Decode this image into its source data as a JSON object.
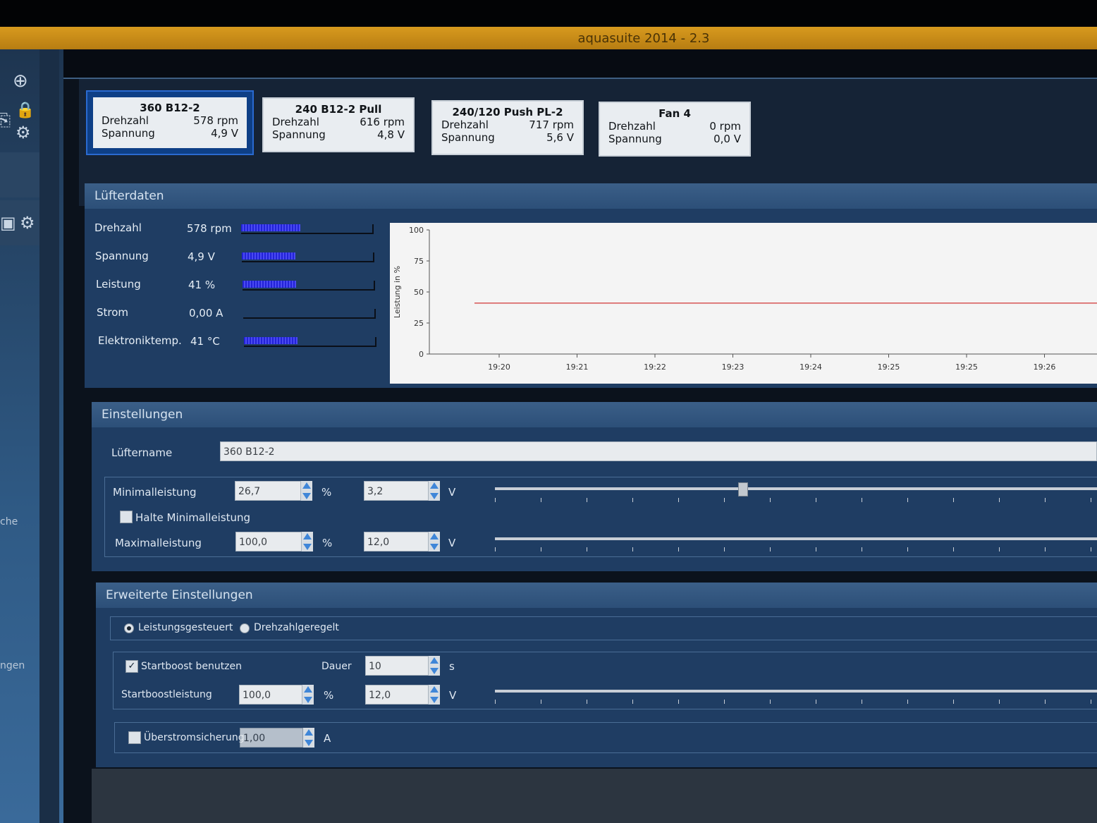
{
  "window": {
    "title": "aquasuite 2014 - 2.3"
  },
  "sidebar": {
    "fragments": [
      "che",
      "ngen"
    ]
  },
  "fans": [
    {
      "name": "360 B12-2",
      "rpm_label": "Drehzahl",
      "rpm": "578 rpm",
      "volt_label": "Spannung",
      "volt": "4,9 V",
      "selected": true
    },
    {
      "name": "240 B12-2 Pull",
      "rpm_label": "Drehzahl",
      "rpm": "616 rpm",
      "volt_label": "Spannung",
      "volt": "4,8 V"
    },
    {
      "name": "240/120 Push PL-2",
      "rpm_label": "Drehzahl",
      "rpm": "717 rpm",
      "volt_label": "Spannung",
      "volt": "5,6 V"
    },
    {
      "name": "Fan 4",
      "rpm_label": "Drehzahl",
      "rpm": "0 rpm",
      "volt_label": "Spannung",
      "volt": "0,0 V"
    }
  ],
  "fan_data": {
    "title": "Lüfterdaten",
    "rows": [
      {
        "label": "Drehzahl",
        "value": "578 rpm",
        "level": 0.45
      },
      {
        "label": "Spannung",
        "value": "4,9 V",
        "level": 0.41
      },
      {
        "label": "Leistung",
        "value": "41 %",
        "level": 0.41
      },
      {
        "label": "Strom",
        "value": "0,00 A",
        "level": 0.0
      },
      {
        "label": "Elektroniktemp.",
        "value": "41 °C",
        "level": 0.41
      }
    ]
  },
  "chart_data": {
    "type": "line",
    "ylabel": "Leistung in %",
    "ylim": [
      0,
      100
    ],
    "yticks": [
      "100",
      "75",
      "50",
      "25",
      "0"
    ],
    "x": [
      "19:20",
      "19:21",
      "19:22",
      "19:23",
      "19:24",
      "19:25",
      "19:25",
      "19:26"
    ],
    "series": [
      {
        "values": [
          41,
          41,
          41,
          41,
          41,
          41,
          41,
          41
        ],
        "color": "#cc1f1f"
      }
    ],
    "grid": false
  },
  "settings": {
    "title": "Einstellungen",
    "fan_name_label": "Lüftername",
    "fan_name": "360 B12-2",
    "min_label": "Minimalleistung",
    "min_percent": "26,7",
    "min_volt": "3,2",
    "min_level": 0.267,
    "hold_min_label": "Halte Minimalleistung",
    "max_label": "Maximalleistung",
    "max_percent": "100,0",
    "max_volt": "12,0",
    "percent_unit": "%",
    "volt_unit": "V"
  },
  "advanced": {
    "title": "Erweiterte Einstellungen",
    "mode_power": "Leistungsgesteuert",
    "mode_rpm": "Drehzahlgeregelt",
    "startboost_label": "Startboost benutzen",
    "duration_label": "Dauer",
    "duration": "10",
    "duration_unit": "s",
    "boost_power_label": "Startboostleistung",
    "boost_percent": "100,0",
    "boost_volt": "12,0",
    "overcurrent_label": "Überstromsicherung",
    "overcurrent": "1,00",
    "current_unit": "A"
  },
  "colors": {
    "accent": "#d89a1e",
    "panel": "#1f3d63",
    "bar": "#2222d8",
    "line": "#cc1f1f"
  }
}
